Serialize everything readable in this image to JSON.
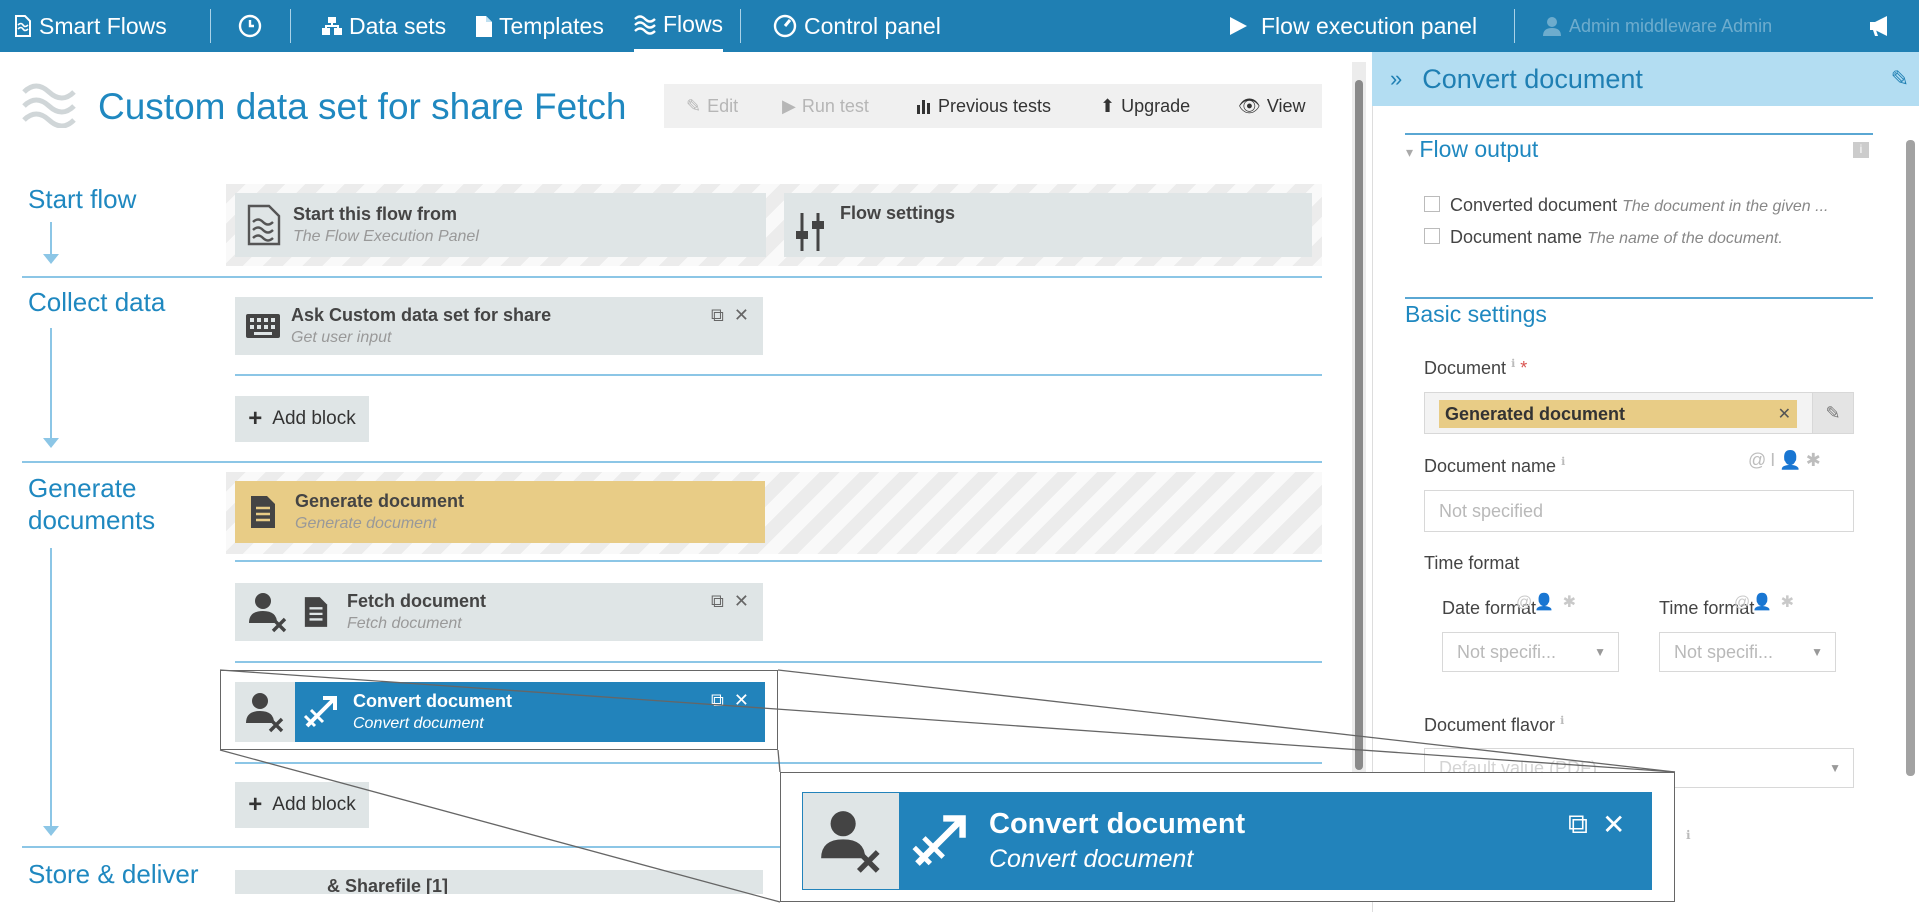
{
  "topbar": {
    "brand": "Smart Flows",
    "data_sets": "Data sets",
    "templates": "Templates",
    "flows": "Flows",
    "control_panel": "Control panel",
    "flow_execution_panel": "Flow execution panel",
    "user": "Admin  middleware  Admin",
    "accent": "#1f7fb3"
  },
  "page": {
    "title": "Custom data set for share Fetch",
    "actions": {
      "edit": "Edit",
      "run_test": "Run test",
      "previous_tests": "Previous tests",
      "upgrade": "Upgrade",
      "view": "View"
    }
  },
  "sections": {
    "start_flow": "Start flow",
    "collect_data": "Collect data",
    "generate_line1": "Generate",
    "generate_line2": "documents",
    "store_deliver": "Store & deliver"
  },
  "blocks": {
    "start_this_flow": {
      "title": "Start this flow from",
      "subtitle": "The Flow Execution Panel"
    },
    "flow_settings": {
      "title": "Flow settings"
    },
    "ask": {
      "title": "Ask Custom data set for share",
      "subtitle": "Get user input"
    },
    "generate": {
      "title": "Generate document",
      "subtitle": "Generate document"
    },
    "fetch": {
      "title": "Fetch document",
      "subtitle": "Fetch document"
    },
    "convert": {
      "title": "Convert document",
      "subtitle": "Convert document"
    },
    "store_partial": "& Sharefile [1]"
  },
  "add_block": "Add block",
  "panel": {
    "title": "Convert document",
    "flow_output": "Flow output",
    "outputs": [
      {
        "name": "Converted document",
        "desc": "The document in the given ..."
      },
      {
        "name": "Document name",
        "desc": "The name of the document."
      }
    ],
    "basic_settings": "Basic settings",
    "document_label": "Document",
    "required_mark": "*",
    "document_value": "Generated document",
    "document_name_label": "Document name",
    "document_name_placeholder": "Not specified",
    "time_format_label": "Time format",
    "date_format_label": "Date format",
    "date_format_value": "Not specifi...",
    "time_format_sub_label": "Time format",
    "time_format_value": "Not specifi...",
    "document_flavor_label": "Document flavor",
    "document_flavor_value": "Default value (PDF)"
  },
  "zoom": {
    "title": "Convert document",
    "subtitle": "Convert document"
  },
  "colors": {
    "selected_block": "#2283bb",
    "generate_block": "#e8cc86",
    "section_text": "#1f88c0"
  }
}
